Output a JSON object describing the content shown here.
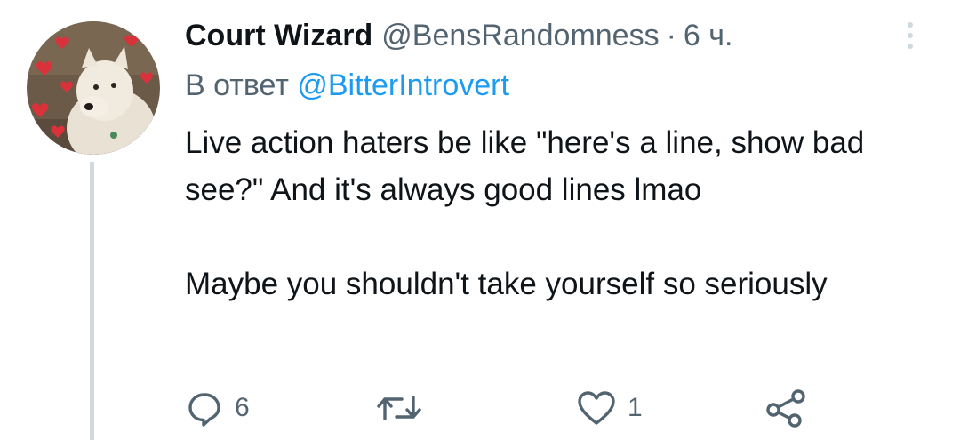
{
  "tweet": {
    "display_name": "Court Wizard",
    "handle": "@BensRandomness",
    "separator": "·",
    "time": "6 ч.",
    "reply_prefix": "В ответ",
    "reply_handle": "@BitterIntrovert",
    "text_line1": "Live action haters be like \"here's a line, show bad see?\" And it's always good lines lmao",
    "text_line2": "Maybe you shouldn't take yourself so seriously"
  },
  "actions": {
    "reply_count": "6",
    "retweet_count": "",
    "like_count": "1"
  },
  "icons": {
    "more": "more-vertical-icon",
    "reply": "reply-icon",
    "retweet": "retweet-icon",
    "like": "heart-icon",
    "share": "share-icon"
  },
  "colors": {
    "text": "#0f1419",
    "muted": "#536471",
    "link": "#1d9bf0",
    "thread_line": "#cfd9de"
  }
}
